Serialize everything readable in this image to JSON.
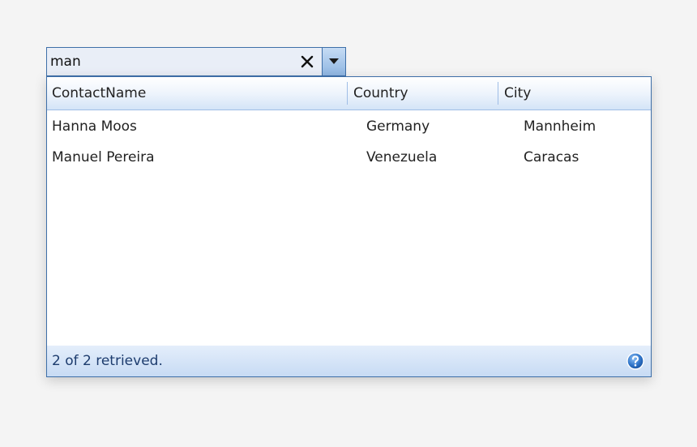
{
  "search": {
    "value": "man",
    "clear_glyph": "✕"
  },
  "grid": {
    "columns": [
      "ContactName",
      "Country",
      "City"
    ],
    "rows": [
      {
        "contact": "Hanna Moos",
        "country": "Germany",
        "city": "Mannheim"
      },
      {
        "contact": "Manuel Pereira",
        "country": "Venezuela",
        "city": "Caracas"
      }
    ]
  },
  "status": {
    "text": "2 of 2 retrieved."
  },
  "colors": {
    "accent": "#3e6fa8",
    "status_text": "#1d3c6e"
  },
  "icons": {
    "clear": "close-icon",
    "dropdown": "caret-down-icon",
    "help": "help-icon"
  }
}
